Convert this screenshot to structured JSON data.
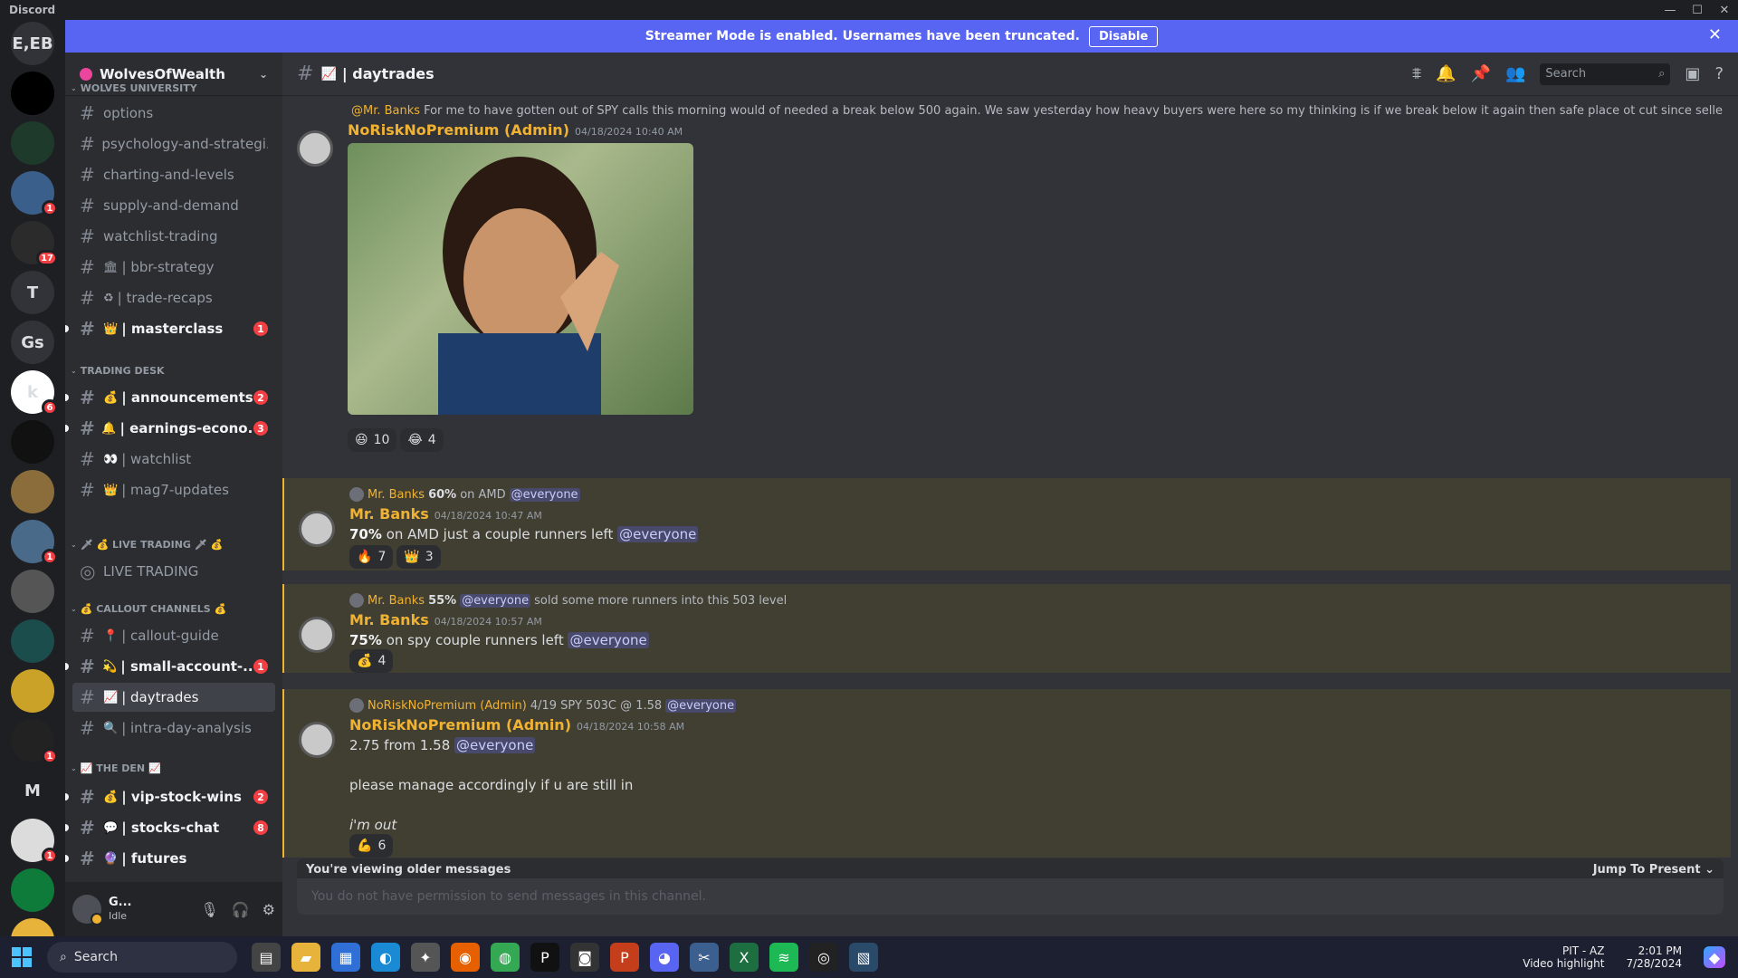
{
  "app": {
    "title": "Discord",
    "window_controls": [
      "—",
      "☐",
      "✕"
    ]
  },
  "banner": {
    "text": "Streamer Mode is enabled. Usernames have been truncated.",
    "disable": "Disable"
  },
  "servers": [
    {
      "label": "E,EB",
      "color": "#313338"
    },
    {
      "label": "",
      "color": "#000000"
    },
    {
      "label": "",
      "color": "#1e3a2a"
    },
    {
      "label": "",
      "color": "#3a5f8a",
      "badge": "1"
    },
    {
      "label": "",
      "color": "#2b2b2b",
      "badge": "17"
    },
    {
      "label": "T",
      "color": "#313338"
    },
    {
      "label": "Gs",
      "color": "#313338"
    },
    {
      "label": "k",
      "color": "#ffffff",
      "badge": "6"
    },
    {
      "label": "",
      "color": "#111111"
    },
    {
      "label": "",
      "color": "#8a6d3b"
    },
    {
      "label": "",
      "color": "#4a6a8a",
      "badge": "1"
    },
    {
      "label": "",
      "color": "#555555"
    },
    {
      "label": "",
      "color": "#1b4d4d"
    },
    {
      "label": "",
      "color": "#c9a227"
    },
    {
      "label": "",
      "color": "#222222",
      "badge": "1"
    },
    {
      "label": "M",
      "color": "#1e1f22"
    },
    {
      "label": "",
      "color": "#dcdcdc",
      "badge": "1"
    },
    {
      "label": "",
      "color": "#0f7b3a"
    },
    {
      "label": "",
      "color": "#e8b33a"
    }
  ],
  "guild": {
    "name": "WolvesOfWealth"
  },
  "categories": {
    "c1": "WOLVES UNIVERSITY",
    "c2": "TRADING DESK",
    "c3": "🗡 💰 LIVE TRADING 🗡 💰",
    "c4": "💰 CALLOUT CHANNELS 💰",
    "c5": "📈 THE DEN 📈"
  },
  "channels": [
    {
      "name": "options",
      "emoji": "",
      "y": 0
    },
    {
      "name": "psychology-and-strategi...",
      "emoji": ""
    },
    {
      "name": "charting-and-levels",
      "emoji": ""
    },
    {
      "name": "supply-and-demand",
      "emoji": ""
    },
    {
      "name": "watchlist-trading",
      "emoji": ""
    },
    {
      "name": "| bbr-strategy",
      "emoji": "🏛"
    },
    {
      "name": "| trade-recaps",
      "emoji": "♻"
    },
    {
      "name": "| masterclass",
      "emoji": "👑",
      "unread": true,
      "badge": "1"
    },
    {
      "name": "| announcements",
      "emoji": "💰",
      "unread": true,
      "badge": "2"
    },
    {
      "name": "| earnings-econo...",
      "emoji": "🔔",
      "unread": true,
      "badge": "3"
    },
    {
      "name": "| watchlist",
      "emoji": "👀"
    },
    {
      "name": "| mag7-updates",
      "emoji": "👑"
    },
    {
      "name": "LIVE TRADING",
      "emoji": ""
    },
    {
      "name": "| callout-guide",
      "emoji": "📍"
    },
    {
      "name": "| small-account-...",
      "emoji": "💫",
      "unread": true,
      "badge": "1"
    },
    {
      "name": "| daytrades",
      "emoji": "📈",
      "active": true
    },
    {
      "name": "| intra-day-analysis",
      "emoji": "🔍"
    },
    {
      "name": "| vip-stock-wins",
      "emoji": "💰",
      "unread": true,
      "badge": "2"
    },
    {
      "name": "| stocks-chat",
      "emoji": "💬",
      "unread": true,
      "badge": "8"
    },
    {
      "name": "| futures",
      "emoji": "🔮",
      "unread": true
    }
  ],
  "user": {
    "name": "G...",
    "status": "Idle"
  },
  "header": {
    "channel": "| daytrades",
    "search_placeholder": "Search"
  },
  "messages": [
    {
      "reply_name": "@Mr. Banks",
      "reply_text": "For me to have gotten out of SPY calls this morning would of needed a break below 500 again. We saw yesterday how heavy buyers were here so my thinking is if we break below it again then safe place ot cut since sellers are taki...",
      "author": "NoRiskNoPremium (Admin)",
      "time": "04/18/2024 10:40 AM",
      "reactions": [
        {
          "e": "😆",
          "n": "10"
        },
        {
          "e": "😂",
          "n": "4"
        }
      ]
    },
    {
      "reply_name": "Mr. Banks",
      "reply_bold": "60%",
      "reply_text": "on AMD",
      "reply_mention": "@everyone",
      "author": "Mr. Banks",
      "time": "04/18/2024 10:47 AM",
      "bold": "70%",
      "text": "on AMD just a couple runners left",
      "mention": "@everyone",
      "reactions": [
        {
          "e": "🔥",
          "n": "7"
        },
        {
          "e": "👑",
          "n": "3"
        }
      ]
    },
    {
      "reply_name": "Mr. Banks",
      "reply_bold": "55%",
      "reply_mention": "@everyone",
      "reply_text": "sold some more runners into this 503 level",
      "author": "Mr. Banks",
      "time": "04/18/2024 10:57 AM",
      "bold": "75%",
      "text": "on spy couple runners left",
      "mention": "@everyone",
      "reactions": [
        {
          "e": "💰",
          "n": "4"
        }
      ]
    },
    {
      "reply_name": "NoRiskNoPremium (Admin)",
      "reply_text": "4/19 SPY 503C @ 1.58",
      "reply_mention": "@everyone",
      "author": "NoRiskNoPremium (Admin)",
      "time": "04/18/2024 10:58 AM",
      "line1": "2.75 from 1.58",
      "mention": "@everyone",
      "line2": "please manage accordingly if u are still in",
      "line3": "i'm out",
      "reactions": [
        {
          "e": "💪",
          "n": "6"
        }
      ]
    }
  ],
  "older": {
    "text": "You're viewing older messages",
    "jump": "Jump To Present"
  },
  "composer": {
    "placeholder": "You do not have permission to send messages in this channel."
  },
  "taskbar": {
    "search": "Search",
    "weather_title": "PIT - AZ",
    "weather_sub": "Video highlight",
    "time": "2:01 PM",
    "date": "7/28/2024"
  }
}
